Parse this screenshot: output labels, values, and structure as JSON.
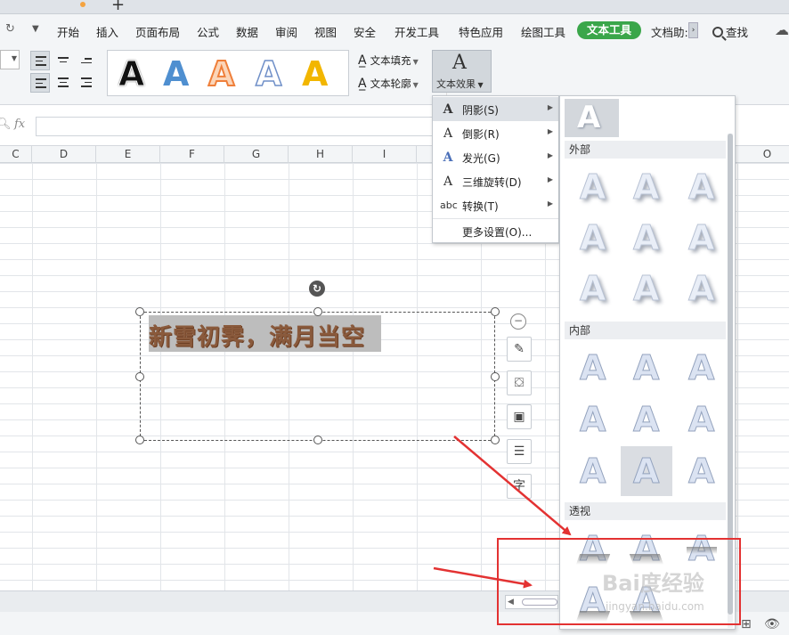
{
  "menubar": {
    "items": [
      "开始",
      "插入",
      "页面布局",
      "公式",
      "数据",
      "审阅",
      "视图",
      "安全",
      "开发工具",
      "特色应用",
      "绘图工具"
    ],
    "active_tab": "文本工具",
    "overflow_tab": "文档助:",
    "search": "查找"
  },
  "ribbon": {
    "fill_label": "文本填充",
    "outline_label": "文本轮廓",
    "effect_label": "文本效果",
    "gallery_glyph": "A"
  },
  "formula": {
    "fx": "fx"
  },
  "columns": [
    "C",
    "D",
    "E",
    "F",
    "G",
    "H",
    "I",
    "O"
  ],
  "textbox": {
    "text": "新雪初霁，满月当空"
  },
  "effect_menu": {
    "items": [
      {
        "icon_glyph": "A",
        "label": "阴影(S)",
        "has_submenu": true
      },
      {
        "icon_glyph": "A",
        "label": "倒影(R)",
        "has_submenu": true
      },
      {
        "icon_glyph": "A",
        "label": "发光(G)",
        "has_submenu": true
      },
      {
        "icon_glyph": "A",
        "label": "三维旋转(D)",
        "has_submenu": true
      },
      {
        "icon_glyph": "abc",
        "label": "转换(T)",
        "has_submenu": true
      }
    ],
    "more": "更多设置(O)..."
  },
  "shadow_panel": {
    "preview_glyph": "A",
    "sections": {
      "outer": "外部",
      "inner": "内部",
      "perspective": "透视"
    },
    "swatch_glyph": "A"
  },
  "watermark": {
    "main": "Bai度经验",
    "sub": "jingyan.baidu.com"
  },
  "colors": {
    "accent_green": "#3aa64a",
    "annotation_red": "#e33232",
    "text_brown": "#8a5a3c"
  }
}
